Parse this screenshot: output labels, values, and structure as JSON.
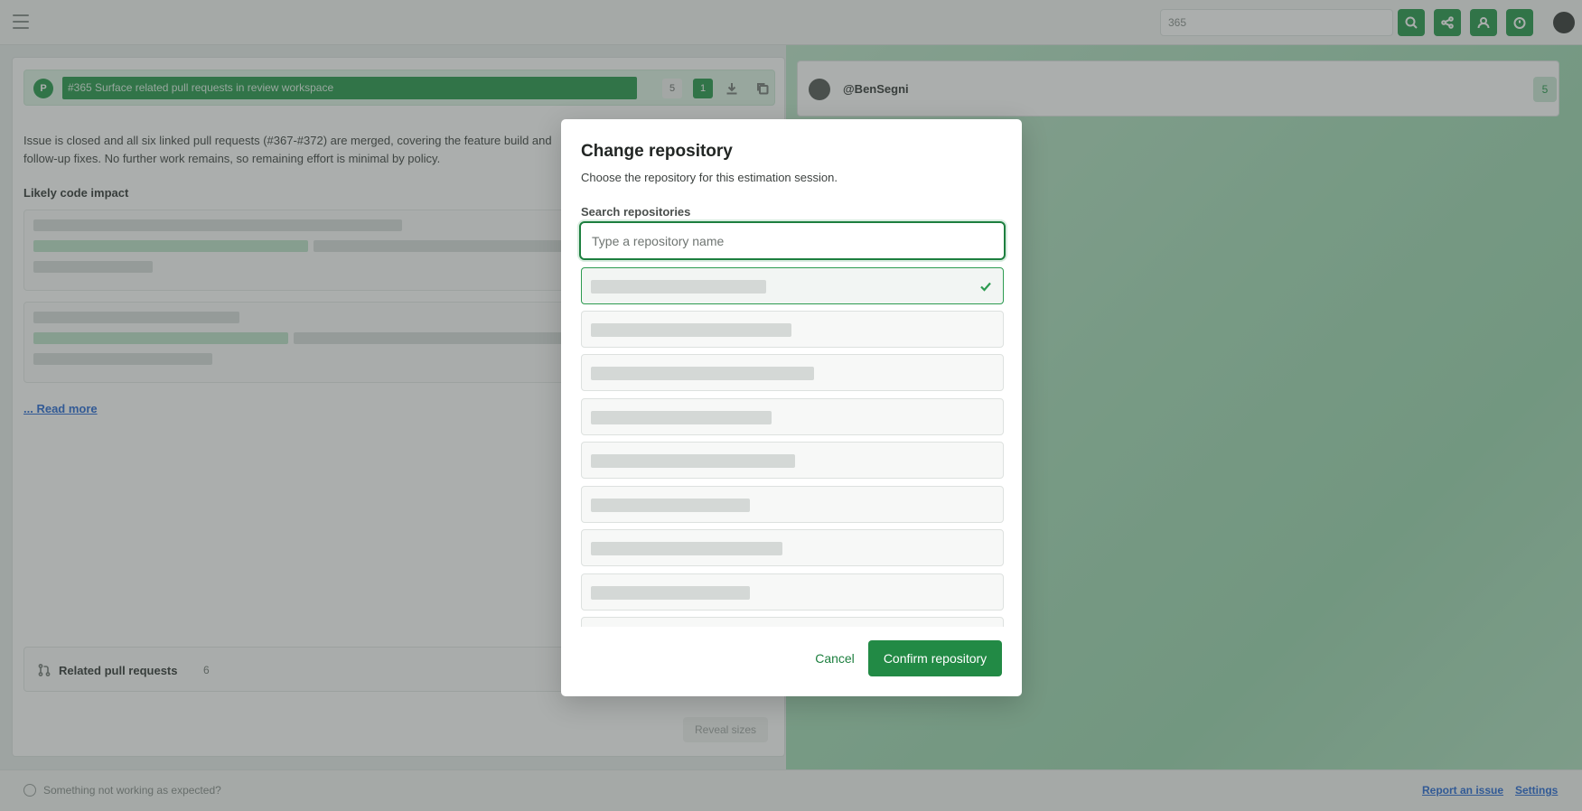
{
  "topbar": {
    "search_value": "365",
    "actions": [
      {
        "icon": "search-icon"
      },
      {
        "icon": "share-icon"
      },
      {
        "icon": "user-icon"
      },
      {
        "icon": "timer-icon"
      }
    ],
    "accent": "#2d9b51"
  },
  "issue": {
    "badge": "P",
    "title": "#365 Surface related pull requests in review workspace",
    "chip_estimate": "5",
    "chip_active": "1",
    "description": "Issue is closed and all six linked pull requests (#367-#372) are merged, covering the feature build and follow-up fixes. No further work remains, so remaining effort is minimal by policy.",
    "likely_impact_label": "Likely code impact",
    "read_more": "... Read more",
    "related_label": "Related pull requests",
    "related_count": "6",
    "reveal_label": "Reveal sizes"
  },
  "participant": {
    "name": "@BenSegni",
    "estimate": "5"
  },
  "footer": {
    "help_text": "Something not working as expected?",
    "report_link": "Report an issue",
    "settings_link": "Settings"
  },
  "modal": {
    "title": "Change repository",
    "subtitle": "Choose the repository for this estimation session.",
    "search_label": "Search repositories",
    "search_placeholder": "Type a repository name",
    "search_value": "",
    "repositories": [
      {
        "selected": true
      },
      {
        "selected": false
      },
      {
        "selected": false
      },
      {
        "selected": false
      },
      {
        "selected": false
      },
      {
        "selected": false
      },
      {
        "selected": false
      },
      {
        "selected": false
      },
      {
        "selected": false
      }
    ],
    "cancel_label": "Cancel",
    "confirm_label": "Confirm repository"
  }
}
